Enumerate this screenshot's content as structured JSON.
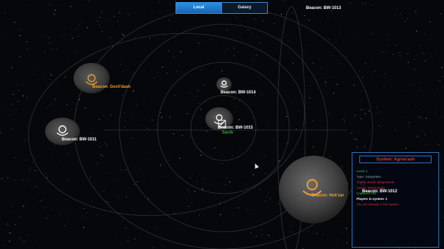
{
  "tabs": [
    {
      "label": "Local",
      "active": true
    },
    {
      "label": "Galaxy",
      "active": false
    }
  ],
  "beacons": [
    {
      "name": "Beacon: BW-1013",
      "color": "#ffffff"
    },
    {
      "name": "Beacon: Gord'dash",
      "color": "#f0a030"
    },
    {
      "name": "Beacon: BW-1014",
      "color": "#ffffff"
    },
    {
      "name": "Beacon: BW-1011",
      "color": "#ffffff"
    },
    {
      "name": "Beacon: BW-1015",
      "color": "#ffffff"
    },
    {
      "name": "Beacon: BW-1012",
      "color": "#ffffff"
    },
    {
      "name": "Beacon: Hok'zar",
      "color": "#f0a030"
    }
  ],
  "ship_label": "Sacib",
  "info_panel": {
    "title": "System: Agrna'ash",
    "level": "Level: 1",
    "type": "Type: Subsystem",
    "about_line1": "About central: Berguzands",
    "about_line2": "Owner: Berguzands",
    "captured": "Captured: NO",
    "players": "Players in system: 1",
    "note": "You are already in this system"
  },
  "colors": {
    "accent_blue": "#2f79c9",
    "faction_orange": "#f0a030",
    "alert_red": "#e02e2e",
    "status_green": "#3fcf4a"
  }
}
